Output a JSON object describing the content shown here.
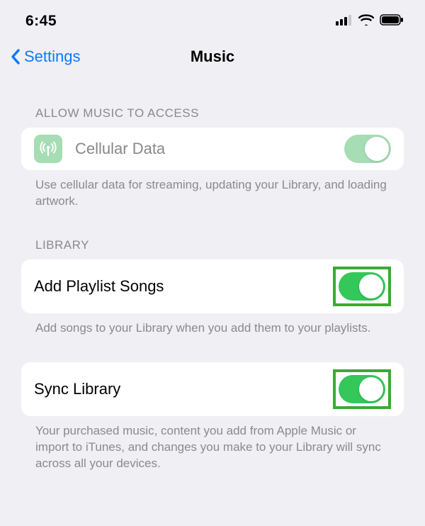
{
  "status": {
    "time": "6:45"
  },
  "nav": {
    "back_label": "Settings",
    "title": "Music"
  },
  "sections": {
    "access": {
      "header": "ALLOW MUSIC TO ACCESS",
      "cellular": {
        "label": "Cellular Data",
        "footer": "Use cellular data for streaming, updating your Library, and loading artwork."
      }
    },
    "library": {
      "header": "LIBRARY",
      "addPlaylist": {
        "label": "Add Playlist Songs",
        "footer": "Add songs to your Library when you add them to your playlists."
      },
      "syncLibrary": {
        "label": "Sync Library",
        "footer": "Your purchased music, content you add from Apple Music or import to iTunes, and changes you make to your Library will sync across all your devices."
      }
    }
  }
}
